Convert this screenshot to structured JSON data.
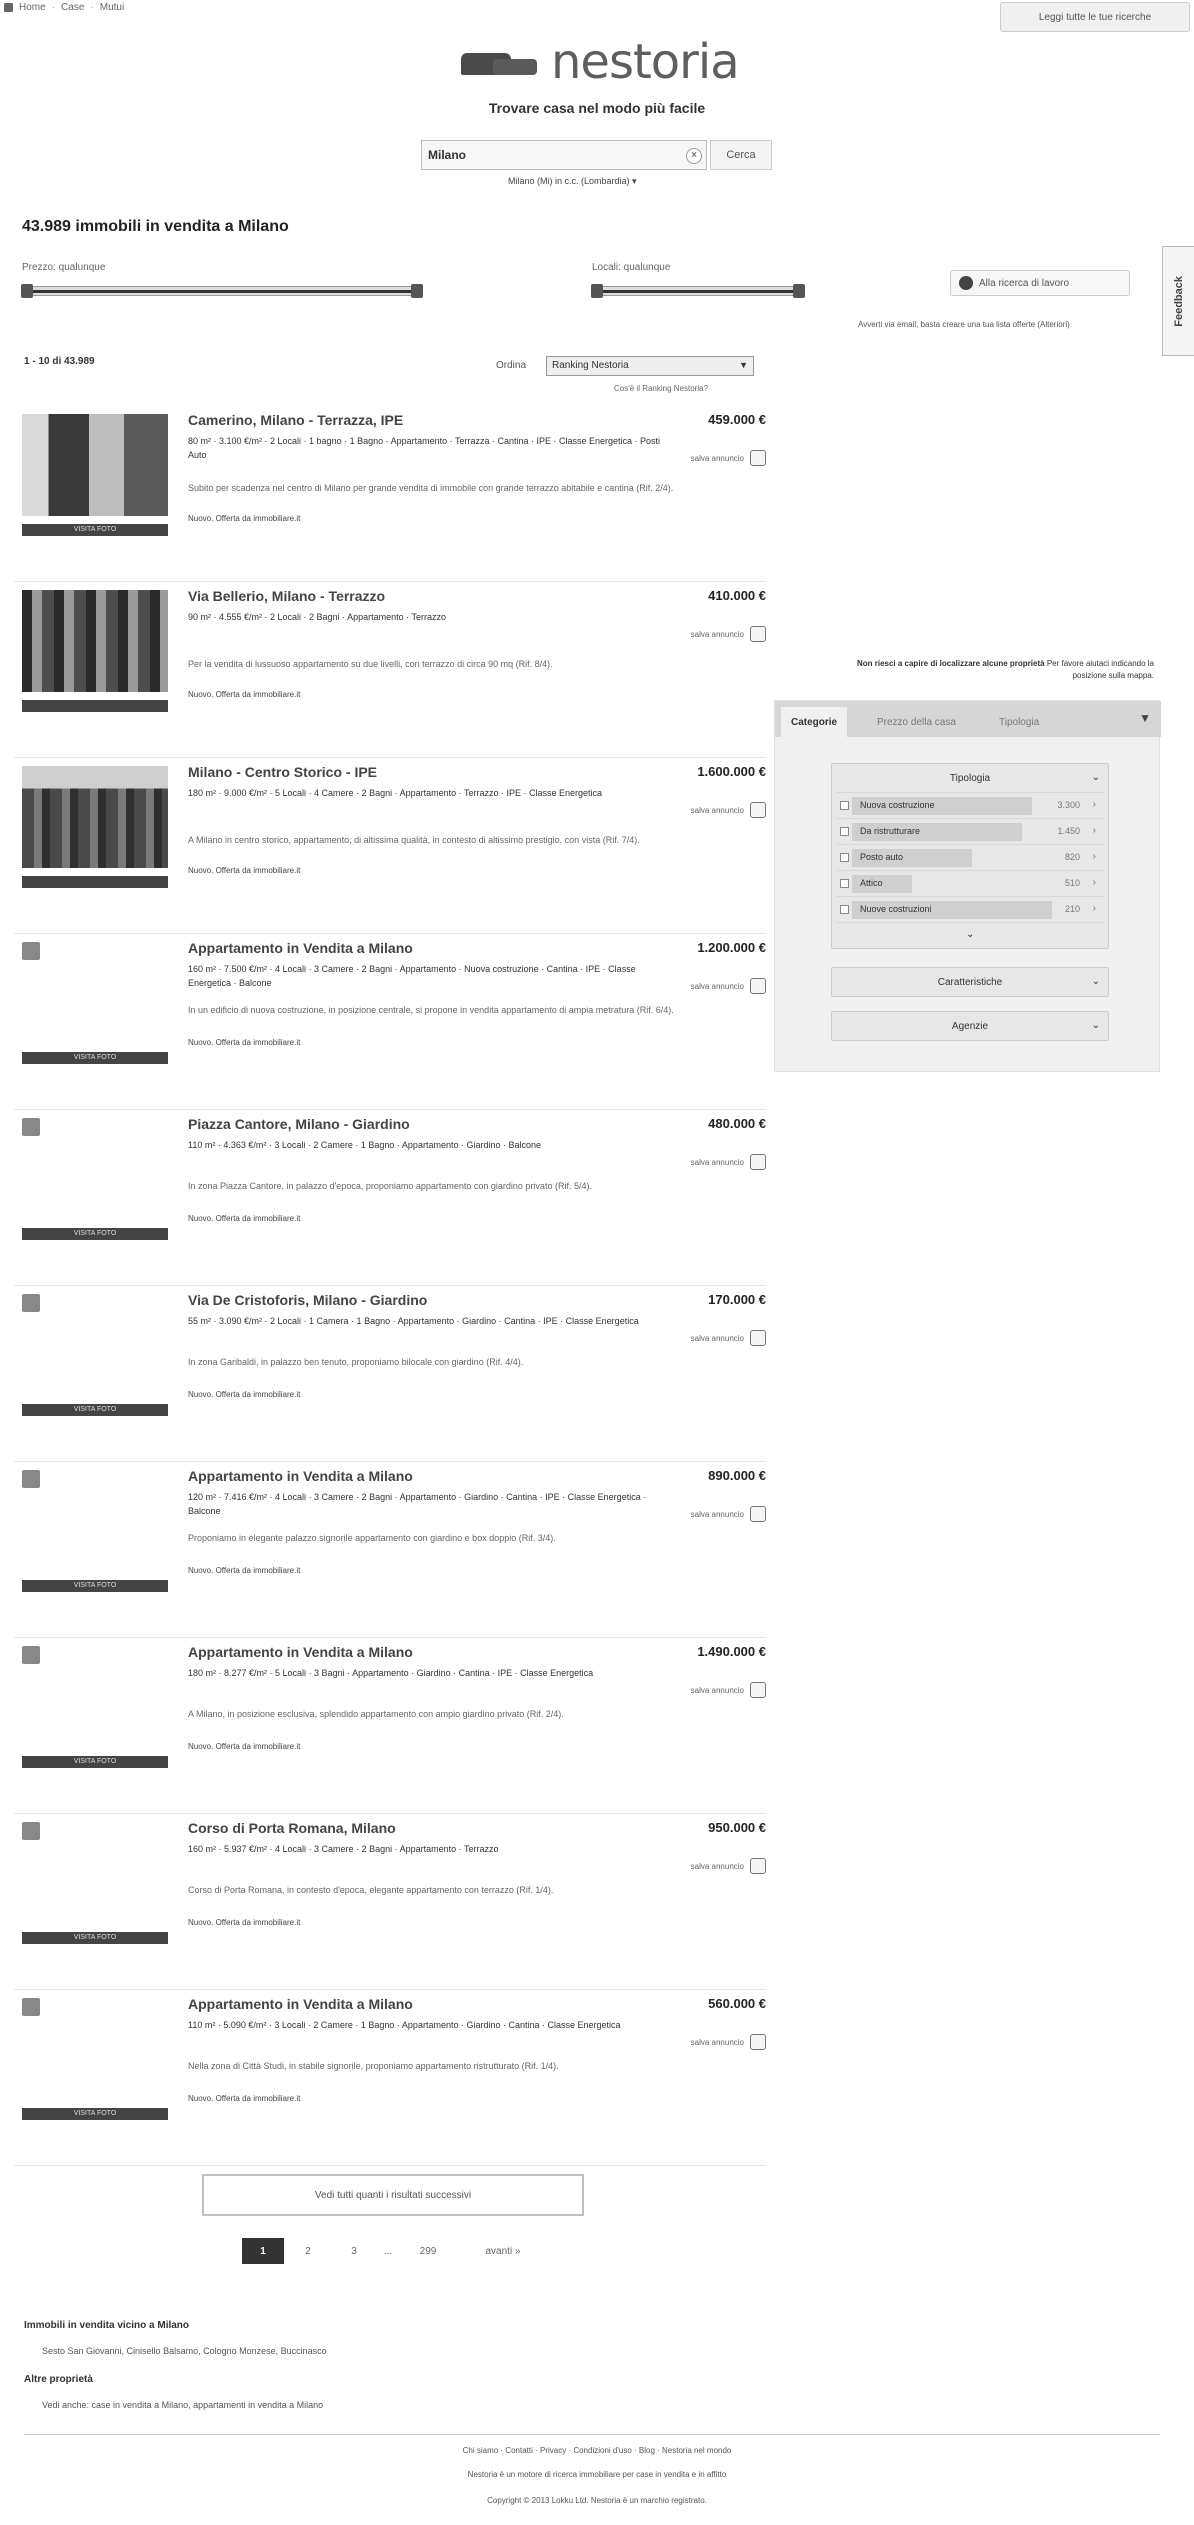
{
  "topnav": {
    "items": [
      "Home",
      "Case",
      "Mutui"
    ],
    "right_button": "Leggi tutte le tue ricerche"
  },
  "logo": {
    "text": "nestoria"
  },
  "tagline": "Trovare casa nel modo più facile",
  "search": {
    "value": "Milano",
    "button": "Cerca",
    "sub": "Milano (Mi) in c.c. (Lombardia) ▾"
  },
  "results_title": "43.989 immobili in vendita a Milano",
  "filters_top": {
    "price_label": "Prezzo: qualunque",
    "rooms_label": "Locali: qualunque",
    "alert": "Alla ricerca di lavoro",
    "alert_note": "Avverti via email, basta creare una tua lista offerte (Alteriori)"
  },
  "feedback": "Feedback",
  "list_head": {
    "count": "1 - 10 di 43.989",
    "sort_label": "Ordina",
    "sort_value": "Ranking Nestoria",
    "sort_note": "Cos'è il Ranking Nestoria?"
  },
  "listings": [
    {
      "title": "Camerino, Milano - Terrazza, IPE",
      "price": "459.000 €",
      "details": "80 m² · 3.100 €/m² · 2 Locali · 1 bagno · 1 Bagno · Appartamento · Terrazza · Cantina · IPE · Classe Energetica · Posti Auto",
      "desc": "Subito per scadenza nel centro di Milano per grande vendita di immobile con grande terrazzo abitabile e cantina (Rif. 2/4).",
      "source": "Nuovo. Offerta da immobiliare.it",
      "save": "salva annuncio",
      "badge": "VISITA FOTO"
    },
    {
      "title": "Via Bellerio, Milano - Terrazzo",
      "price": "410.000 €",
      "details": "90 m² · 4.555 €/m² · 2 Locali · 2 Bagni · Appartamento · Terrazzo",
      "desc": "Per la vendita di lussuoso appartamento su due livelli, con terrazzo di circa 90 mq (Rif. 8/4).",
      "source": "Nuovo. Offerta da immobiliare.it",
      "save": "salva annuncio",
      "badge": ""
    },
    {
      "title": "Milano - Centro Storico - IPE",
      "price": "1.600.000 €",
      "details": "180 m² · 9.000 €/m² · 5 Locali · 4 Camere · 2 Bagni · Appartamento · Terrazzo · IPE · Classe Energetica",
      "desc": "A Milano in centro storico, appartamento, di altissima qualità, in contesto di altissimo prestigio, con vista (Rif. 7/4).",
      "source": "Nuovo. Offerta da immobiliare.it",
      "save": "salva annuncio",
      "badge": ""
    },
    {
      "title": "Appartamento in Vendita a Milano",
      "price": "1.200.000 €",
      "details": "160 m² · 7.500 €/m² · 4 Locali · 3 Camere · 2 Bagni · Appartamento · Nuova costruzione · Cantina · IPE · Classe Energetica · Balcone",
      "desc": "In un edificio di nuova costruzione, in posizione centrale, si propone in vendita appartamento di ampia metratura (Rif. 6/4).",
      "source": "Nuovo. Offerta da immobiliare.it",
      "save": "salva annuncio",
      "badge": "VISITA FOTO"
    },
    {
      "title": "Piazza Cantore, Milano - Giardino",
      "price": "480.000 €",
      "details": "110 m² · 4.363 €/m² · 3 Locali · 2 Camere · 1 Bagno · Appartamento · Giardino · Balcone",
      "desc": "In zona Piazza Cantore, in palazzo d'epoca, proponiamo appartamento con giardino privato (Rif. 5/4).",
      "source": "Nuovo. Offerta da immobiliare.it",
      "save": "salva annuncio",
      "badge": "VISITA FOTO"
    },
    {
      "title": "Via De Cristoforis, Milano - Giardino",
      "price": "170.000 €",
      "details": "55 m² · 3.090 €/m² · 2 Locali · 1 Camera · 1 Bagno · Appartamento · Giardino · Cantina · IPE · Classe Energetica",
      "desc": "In zona Garibaldi, in palazzo ben tenuto, proponiamo bilocale con giardino (Rif. 4/4).",
      "source": "Nuovo. Offerta da immobiliare.it",
      "save": "salva annuncio",
      "badge": "VISITA FOTO"
    },
    {
      "title": "Appartamento in Vendita a Milano",
      "price": "890.000 €",
      "details": "120 m² · 7.416 €/m² · 4 Locali · 3 Camere · 2 Bagni · Appartamento · Giardino · Cantina · IPE · Classe Energetica · Balcone",
      "desc": "Proponiamo in elegante palazzo signorile appartamento con giardino e box doppio (Rif. 3/4).",
      "source": "Nuovo. Offerta da immobiliare.it",
      "save": "salva annuncio",
      "badge": "VISITA FOTO"
    },
    {
      "title": "Appartamento in Vendita a Milano",
      "price": "1.490.000 €",
      "details": "180 m² · 8.277 €/m² · 5 Locali · 3 Bagni · Appartamento · Giardino · Cantina · IPE · Classe Energetica",
      "desc": "A Milano, in posizione esclusiva, splendido appartamento con ampio giardino privato (Rif. 2/4).",
      "source": "Nuovo. Offerta da immobiliare.it",
      "save": "salva annuncio",
      "badge": "VISITA FOTO"
    },
    {
      "title": "Corso di Porta Romana, Milano",
      "price": "950.000 €",
      "details": "160 m² · 5.937 €/m² · 4 Locali · 3 Camere · 2 Bagni · Appartamento · Terrazzo",
      "desc": "Corso di Porta Romana, in contesto d'epoca, elegante appartamento con terrazzo (Rif. 1/4).",
      "source": "Nuovo. Offerta da immobiliare.it",
      "save": "salva annuncio",
      "badge": "VISITA FOTO"
    },
    {
      "title": "Appartamento in Vendita a Milano",
      "price": "560.000 €",
      "details": "110 m² · 5.090 €/m² · 3 Locali · 2 Camere · 1 Bagno · Appartamento · Giardino · Cantina · Classe Energetica",
      "desc": "Nella zona di Città Studi, in stabile signorile, proponiamo appartamento ristrutturato (Rif. 1/4).",
      "source": "Nuovo. Offerta da immobiliare.it",
      "save": "salva annuncio",
      "badge": "VISITA FOTO"
    }
  ],
  "side": {
    "note_bold": "Non riesci a capire di localizzare alcune proprietà",
    "note_rest": "Per favore aiutaci indicando la posizione sulla mappa."
  },
  "filter_panel": {
    "tabs": [
      "Categorie",
      "Prezzo della casa",
      "Tipologia"
    ],
    "type_head": "Tipologia",
    "rows": [
      {
        "label": "Nuova costruzione",
        "num": "3.300"
      },
      {
        "label": "Da ristrutturare",
        "num": "1.450"
      },
      {
        "label": "Posto auto",
        "num": "820"
      },
      {
        "label": "Attico",
        "num": "510"
      },
      {
        "label": "Nuove costruzioni",
        "num": "210"
      }
    ],
    "features_head": "Caratteristiche",
    "agencies_head": "Agenzie"
  },
  "more_results": "Vedi tutti quanti i risultati successivi",
  "pagination": [
    "1",
    "2",
    "3",
    "...",
    "299",
    "avanti »"
  ],
  "footer": {
    "h1": "Immobili in vendita vicino a Milano",
    "t1": "Sesto San Giovanni, Cinisello Balsamo, Cologno Monzese, Buccinasco",
    "h2": "Altre proprietà",
    "t2": "Vedi anche: case in vendita a Milano, appartamenti in vendita a Milano",
    "c1": "Chi siamo · Contatti · Privacy · Condizioni d'uso · Blog · Nestoria nel mondo",
    "c2": "Nestoria è un motore di ricerca immobiliare per case in vendita e in affitto",
    "c3": "Copyright © 2013 Lokku Ltd. Nestoria è un marchio registrato."
  }
}
